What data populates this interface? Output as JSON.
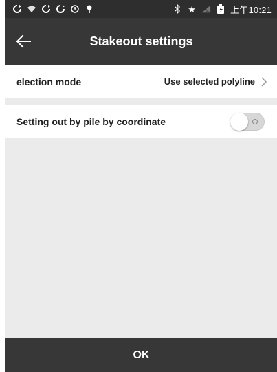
{
  "status_bar": {
    "time": "上午10:21",
    "icons": [
      "sync-icon",
      "wifi-icon",
      "sync-icon",
      "sync-icon",
      "clock-icon",
      "location-icon",
      "bluetooth-icon",
      "star-icon",
      "signal-icon",
      "battery-icon"
    ]
  },
  "app_bar": {
    "title": "Stakeout settings"
  },
  "settings": {
    "selection_mode": {
      "label": "election mode",
      "value": "Use selected polyline"
    },
    "pile_by_coordinate": {
      "label": "Setting out by pile by coordinate",
      "enabled": false
    }
  },
  "footer": {
    "ok_label": "OK"
  },
  "colors": {
    "bar": "#373737",
    "status": "#2e2e2e",
    "background": "#ebebeb"
  }
}
